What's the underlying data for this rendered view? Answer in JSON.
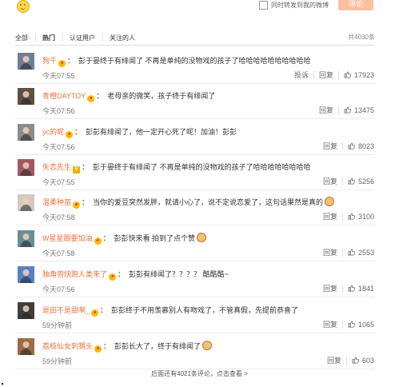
{
  "composer": {
    "sync_label": "同时转发到我的微博",
    "submit_label": "评论"
  },
  "tabs": [
    "全部",
    "热门",
    "认证用户",
    "关注的人"
  ],
  "total_count": "共4030条",
  "comments": [
    {
      "name": "狗千",
      "badge": "emoji",
      "text": "彭于晏终于有绯闻了 不再是单纯的没物戏的孩子了哈哈哈哈哈哈哈哈哈哈",
      "time": "今天07:55",
      "actions": [
        "投诉",
        "回复"
      ],
      "likes": "17923",
      "avatar_color": "#6f7f98"
    },
    {
      "name": "青橙DAYTOY",
      "badge": "emoji",
      "text": "老母亲的微笑，孩子终于有绯闻了",
      "time": "今天07:56",
      "actions": [
        "回复"
      ],
      "likes": "13475",
      "avatar_color": "#5d5145"
    },
    {
      "name": "yc的呢",
      "badge": "emoji",
      "text": "彭彭有绯闻了，他一定开心死了呢！加油！彭彭",
      "time": "今天07:56",
      "actions": [
        "回复"
      ],
      "likes": "8023",
      "avatar_color": "#8b8b8b"
    },
    {
      "name": "失恋先生",
      "badge": "v",
      "text": "彭于晏终于有绯闻了 不再是单纯的没物戏的孩子了哈哈哈哈哈哈哈哈",
      "time": "今天07:55",
      "actions": [
        "回复"
      ],
      "likes": "5256",
      "avatar_color": "#9d5a65"
    },
    {
      "name": "温柔种苗",
      "badge": "emoji",
      "text": "当你的爱豆突然发胖，就请小心了，说不定说恋爱了，这句话果然是真的",
      "time": "今天07:58",
      "actions": [
        "回复"
      ],
      "likes": "3100",
      "avatar_color": "#d1c8c2",
      "end_emoji": true
    },
    {
      "name": "W星星跟要加油",
      "badge": "emoji",
      "text": "彭彭快来看 拍到了点个赞",
      "time": "今天07:58",
      "actions": [
        "回复"
      ],
      "likes": "2553",
      "avatar_color": "#6b8e96",
      "end_emoji": true
    },
    {
      "name": "独角兽快跑人类来了",
      "badge": "emoji",
      "text": "彭彭有绯闻了？？？？ 酷酷酷~",
      "time": "今天07:56",
      "actions": [
        "回复"
      ],
      "likes": "1841",
      "avatar_color": "#5a7fc1"
    },
    {
      "name": "是田不是甜啊_",
      "badge": "emoji",
      "text": "彭彭终于不用羡慕别人有吻戏了，不管真假，先提前恭喜了",
      "time": "59分钟前",
      "actions": [
        "回复"
      ],
      "likes": "1065",
      "avatar_color": "#3e3e3e"
    },
    {
      "name": "荔枝仙女刺猬头",
      "badge": "emoji",
      "text": "彭彭长大了，终于有绯闻了",
      "time": "59分钟前",
      "actions": [
        "回复"
      ],
      "likes": "603",
      "avatar_color": "#9a6c43",
      "end_emoji": true
    }
  ],
  "more_text": "后面还有4021条评论，点击查看 >"
}
